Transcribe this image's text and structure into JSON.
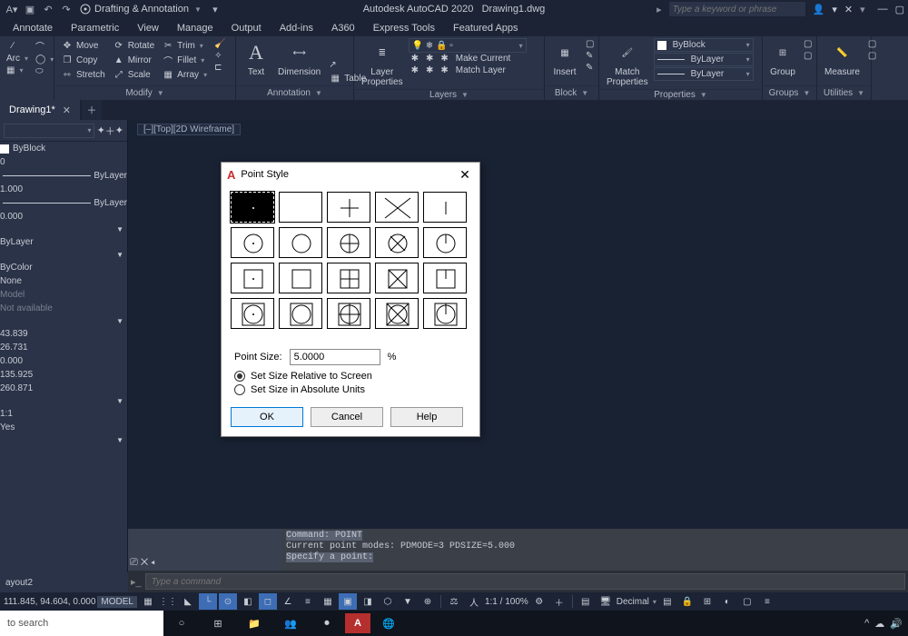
{
  "app": {
    "title": "Autodesk AutoCAD 2020",
    "document": "Drawing1.dwg",
    "workspace": "Drafting & Annotation",
    "search_placeholder": "Type a keyword or phrase"
  },
  "tabs": [
    "Annotate",
    "Parametric",
    "View",
    "Manage",
    "Output",
    "Add-ins",
    "A360",
    "Express Tools",
    "Featured Apps"
  ],
  "ribbon": {
    "modify": {
      "move": "Move",
      "rotate": "Rotate",
      "trim": "Trim",
      "copy": "Copy",
      "mirror": "Mirror",
      "fillet": "Fillet",
      "stretch": "Stretch",
      "scale": "Scale",
      "array": "Array",
      "title": "Modify"
    },
    "annotation": {
      "text": "Text",
      "dimension": "Dimension",
      "table": "Table",
      "title": "Annotation"
    },
    "layers": {
      "props": "Layer\nProperties",
      "makecurrent": "Make Current",
      "matchlayer": "Match Layer",
      "title": "Layers"
    },
    "block": {
      "insert": "Insert",
      "title": "Block"
    },
    "properties": {
      "match": "Match\nProperties",
      "byblock": "ByBlock",
      "bylayer1": "ByLayer",
      "bylayer2": "ByLayer",
      "title": "Properties"
    },
    "groups": {
      "group": "Group",
      "title": "Groups"
    },
    "utilities": {
      "measure": "Measure",
      "title": "Utilities"
    },
    "draw": {
      "line": "Line",
      "arc": "Arc"
    }
  },
  "filetabs": {
    "active": "Drawing1*"
  },
  "viewport": {
    "label": "[–][Top][2D Wireframe]"
  },
  "palette": {
    "byblock": "ByBlock",
    "zero": "0",
    "bylayer": "ByLayer",
    "lw": "1.000",
    "bylayer2": "ByLayer",
    "zero2": "0.000",
    "bylayer3": "ByLayer",
    "bycolor": "ByColor",
    "none": "None",
    "model": "Model",
    "na": "Not available",
    "v1": "43.839",
    "v2": "26.731",
    "v3": "0.000",
    "v4": "135.925",
    "v5": "260.871",
    "scale": "1:1",
    "yes": "Yes"
  },
  "cmd": {
    "l1": "Command: POINT",
    "l2": "Current point modes:  PDMODE=3  PDSIZE=5.000",
    "l3": "Specify a point:",
    "placeholder": "Type a command"
  },
  "layout": "ayout2",
  "status": {
    "coords": "111.845, 94.604, 0.000",
    "model": "MODEL",
    "scale": "1:1 / 100%",
    "decimal": "Decimal"
  },
  "dialog": {
    "title": "Point Style",
    "pointsize_label": "Point Size:",
    "pointsize": "5.0000",
    "unit": "%",
    "opt1": "Set Size Relative to Screen",
    "opt2": "Set Size in Absolute Units",
    "ok": "OK",
    "cancel": "Cancel",
    "help": "Help"
  },
  "search": "to search"
}
